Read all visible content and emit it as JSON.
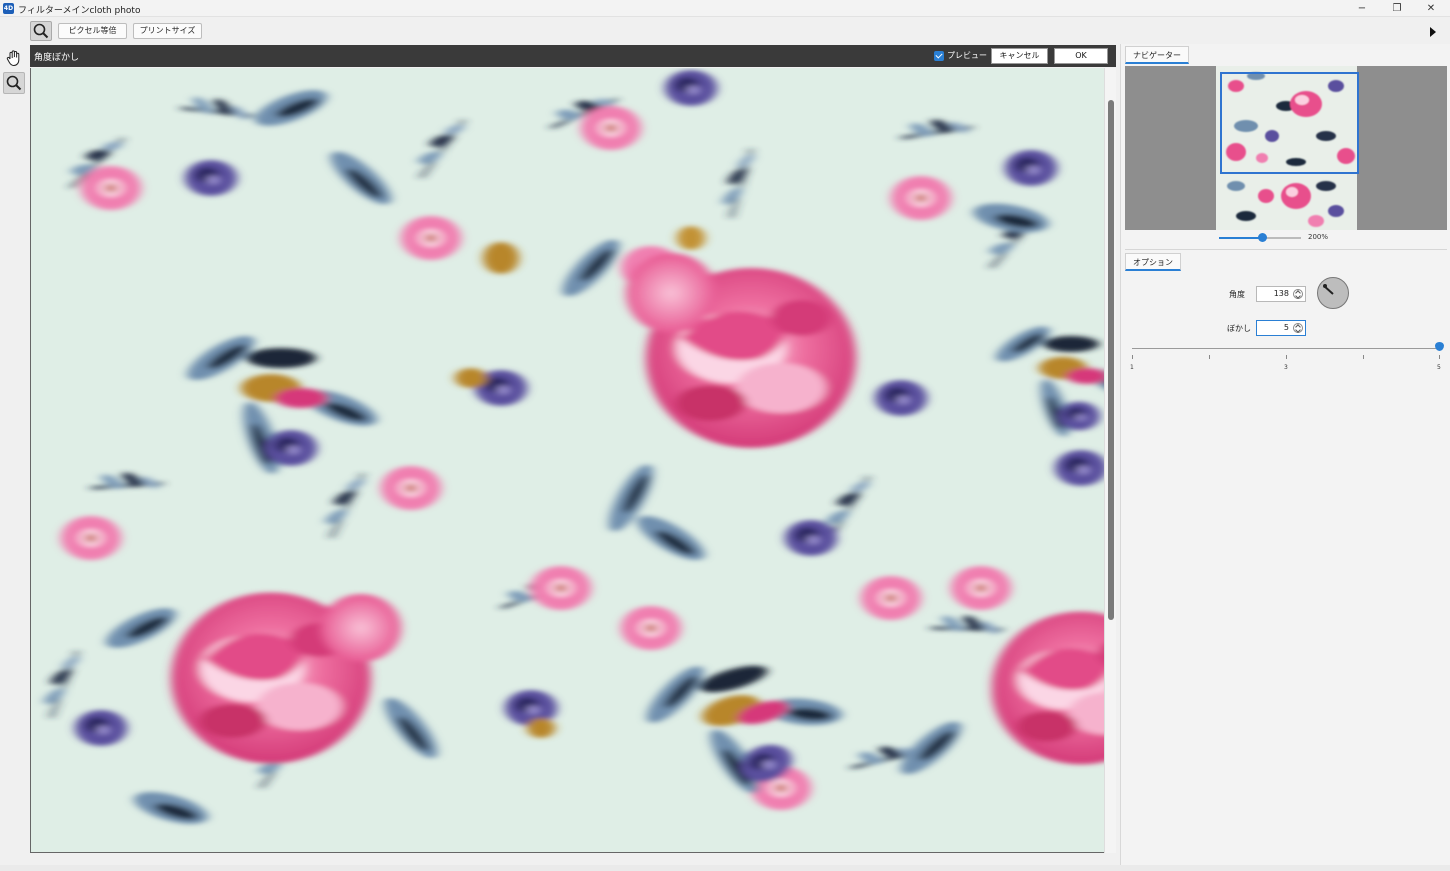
{
  "window": {
    "title": "フィルターメインcloth photo",
    "minimize": "−",
    "restore": "❐",
    "close": "✕"
  },
  "toolbar": {
    "pixel_button": "ピクセル等倍",
    "print_button": "プリントサイズ"
  },
  "filter": {
    "title": "角度ぼかし",
    "preview_label": "プレビュー",
    "preview_checked": true,
    "cancel_label": "キャンセル",
    "ok_label": "OK"
  },
  "navigator": {
    "tab_label": "ナビゲーター",
    "zoom_label": "200%"
  },
  "options": {
    "tab_label": "オプション",
    "angle_label": "角度",
    "angle_value": "138",
    "blur_label": "ぼかし",
    "blur_value": "5",
    "slider_ticks": [
      "1",
      "3",
      "5"
    ]
  },
  "colors": {
    "accent": "#2a7fd4",
    "filter_bar": "#3a3a3a",
    "fabric_bg": "#dfeee6",
    "rose_pink": "#e8508c",
    "leaf_blue": "#6f8fae",
    "violet": "#5a4f9e",
    "ochre": "#b8862a"
  },
  "icons": {
    "zoom_tool": "magnifier-icon",
    "hand_tool": "hand-icon",
    "panel_toggle": "triangle-right-icon"
  }
}
